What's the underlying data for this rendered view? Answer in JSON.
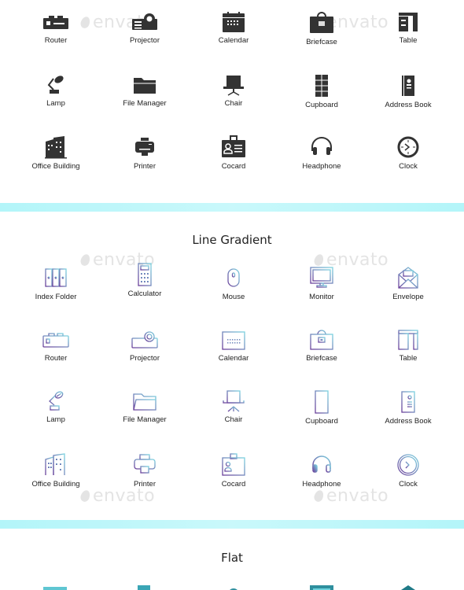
{
  "sections": {
    "glyph": {
      "rows": [
        [
          "Router",
          "Projector",
          "Calendar",
          "Briefcase",
          "Table"
        ],
        [
          "Lamp",
          "File Manager",
          "Chair",
          "Cupboard",
          "Address Book"
        ],
        [
          "Office Building",
          "Printer",
          "Cocard",
          "Headphone",
          "Clock"
        ]
      ]
    },
    "line_gradient": {
      "title": "Line Gradient",
      "rows": [
        [
          "Index Folder",
          "Calculator",
          "Mouse",
          "Monitor",
          "Envelope"
        ],
        [
          "Router",
          "Projector",
          "Calendar",
          "Briefcase",
          "Table"
        ],
        [
          "Lamp",
          "File Manager",
          "Chair",
          "Cupboard",
          "Address Book"
        ],
        [
          "Office Building",
          "Printer",
          "Cocard",
          "Headphone",
          "Clock"
        ]
      ]
    },
    "flat": {
      "title": "Flat"
    }
  },
  "watermark": {
    "text": "envato"
  },
  "colors": {
    "glyph": "#333333",
    "band": "#b3f5f9",
    "grad_start": "#7dd3e0",
    "grad_end": "#7b4fa8",
    "flat": "#3aa5b5"
  }
}
